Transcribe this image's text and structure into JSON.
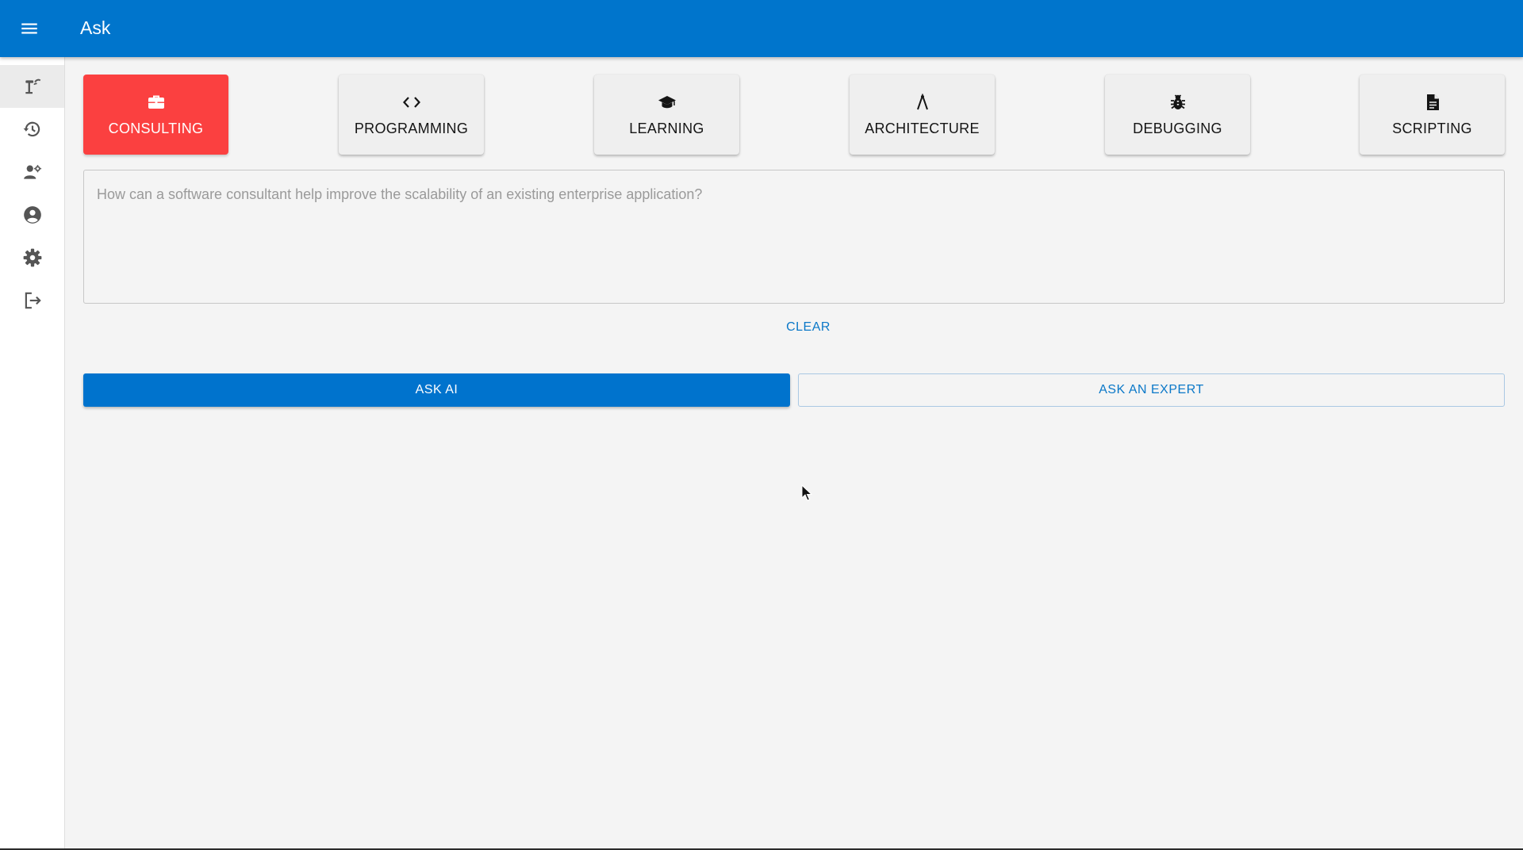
{
  "appbar": {
    "title": "Ask",
    "menu_icon": "hamburger-menu-icon",
    "color": "#0075cc"
  },
  "sidebar": {
    "items": [
      {
        "icon": "ask-icon",
        "active": true
      },
      {
        "icon": "history-icon",
        "active": false
      },
      {
        "icon": "experts-icon",
        "active": false
      },
      {
        "icon": "account-icon",
        "active": false
      },
      {
        "icon": "settings-icon",
        "active": false
      },
      {
        "icon": "logout-icon",
        "active": false
      }
    ]
  },
  "categories": [
    {
      "label": "CONSULTING",
      "icon": "briefcase-icon",
      "selected": true
    },
    {
      "label": "PROGRAMMING",
      "icon": "code-icon",
      "selected": false
    },
    {
      "label": "LEARNING",
      "icon": "graduation-cap-icon",
      "selected": false
    },
    {
      "label": "ARCHITECTURE",
      "icon": "compass-icon",
      "selected": false
    },
    {
      "label": "DEBUGGING",
      "icon": "bug-icon",
      "selected": false
    },
    {
      "label": "SCRIPTING",
      "icon": "document-icon",
      "selected": false
    }
  ],
  "question": {
    "value": "",
    "placeholder": "How can a software consultant help improve the scalability of an existing enterprise application?"
  },
  "actions": {
    "clear_label": "CLEAR",
    "ask_ai_label": "ASK AI",
    "ask_expert_label": "ASK AN EXPERT"
  },
  "colors": {
    "primary": "#0073cd",
    "selected_category": "#fb4040",
    "link": "#0b78c8"
  }
}
